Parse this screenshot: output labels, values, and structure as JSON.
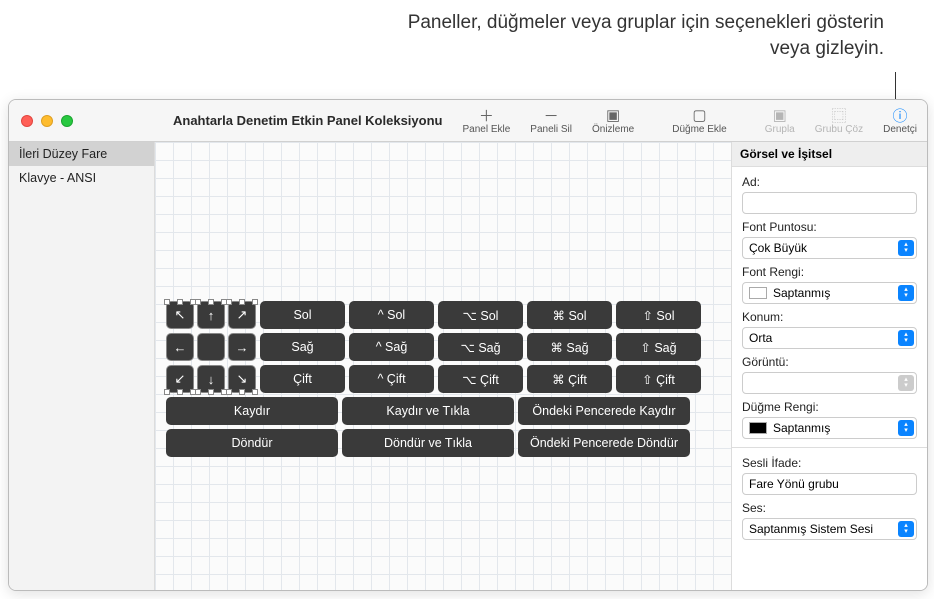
{
  "callout": "Paneller, düğmeler veya gruplar için seçenekleri gösterin veya gizleyin.",
  "window": {
    "title": "Anahtarla Denetim Etkin Panel Koleksiyonu"
  },
  "toolbar": {
    "panel_ekle": "Panel Ekle",
    "paneli_sil": "Paneli Sil",
    "onizleme": "Önizleme",
    "dugme_ekle": "Düğme Ekle",
    "grupla": "Grupla",
    "grubu_coz": "Grubu Çöz",
    "denetci": "Denetçi"
  },
  "sidebar": {
    "items": [
      {
        "label": "İleri Düzey Fare"
      },
      {
        "label": "Klavye - ANSI"
      }
    ]
  },
  "panel": {
    "arrow_rows": [
      [
        "↖",
        "↑",
        "↗"
      ],
      [
        "←",
        "",
        "→"
      ],
      [
        "↙",
        "↓",
        "↘"
      ]
    ],
    "key_cols": [
      "Sol",
      "^ Sol",
      "⌥ Sol",
      "⌘ Sol",
      "⇧ Sol"
    ],
    "key_cols_r2": [
      "Sağ",
      "^ Sağ",
      "⌥ Sağ",
      "⌘ Sağ",
      "⇧ Sağ"
    ],
    "key_cols_r3": [
      "Çift",
      "^ Çift",
      "⌥ Çift",
      "⌘ Çift",
      "⇧ Çift"
    ],
    "wide_r1": [
      "Kaydır",
      "Kaydır ve Tıkla",
      "Öndeki Pencerede Kaydır"
    ],
    "wide_r2": [
      "Döndür",
      "Döndür ve Tıkla",
      "Öndeki Pencerede Döndür"
    ]
  },
  "inspector": {
    "section_title": "Görsel ve İşitsel",
    "ad_label": "Ad:",
    "font_puntosu_label": "Font Puntosu:",
    "font_puntosu_value": "Çok Büyük",
    "font_rengi_label": "Font Rengi:",
    "font_rengi_value": "Saptanmış",
    "konum_label": "Konum:",
    "konum_value": "Orta",
    "goruntu_label": "Görüntü:",
    "goruntu_value": "",
    "dugme_rengi_label": "Düğme Rengi:",
    "dugme_rengi_value": "Saptanmış",
    "sesli_ifade_label": "Sesli İfade:",
    "sesli_ifade_value": "Fare Yönü grubu",
    "ses_label": "Ses:",
    "ses_value": "Saptanmış Sistem Sesi"
  }
}
